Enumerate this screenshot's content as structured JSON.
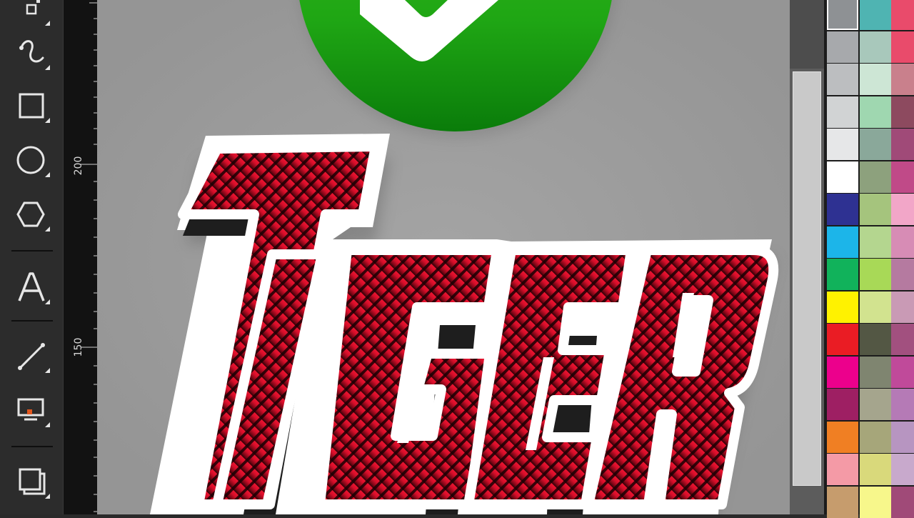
{
  "app": {
    "title": ""
  },
  "ruler": {
    "labels": [
      "200",
      "150"
    ]
  },
  "tools": [
    {
      "name": "shape-edit-tool",
      "icon": "node-edit-icon"
    },
    {
      "name": "freehand-tool",
      "icon": "curve-icon"
    },
    {
      "name": "rectangle-tool",
      "icon": "rectangle-icon"
    },
    {
      "name": "ellipse-tool",
      "icon": "ellipse-icon"
    },
    {
      "name": "polygon-tool",
      "icon": "hexagon-icon"
    },
    {
      "name": "text-tool",
      "icon": "text-icon",
      "label": "A"
    },
    {
      "name": "dimension-tool",
      "icon": "line-icon"
    },
    {
      "name": "interactive-fill-tool",
      "icon": "fill-icon"
    },
    {
      "name": "transparency-tool",
      "icon": "stack-icon"
    }
  ],
  "artwork": {
    "logo_text": "TIGER",
    "badge_icon": "checkmark-icon",
    "colors": {
      "badge_green_top": "#3cc21f",
      "badge_green_bottom": "#0a7c0a",
      "letter_red": "#d40e2a",
      "letter_dark": "#2a0006",
      "outline_white": "#ffffff",
      "shadow": "#1e1e1e"
    }
  },
  "palette": {
    "selected_index": 0,
    "columns": [
      [
        "#8e9194",
        "#a7a9ac",
        "#bcbec0",
        "#d1d3d4",
        "#e6e7e8",
        "#ffffff",
        "#2e3192",
        "#1cb5e9",
        "#11b25b",
        "#fff200",
        "#ea1c24",
        "#ec008c",
        "#9e1f63",
        "#f07f23",
        "#f49aa6",
        "#c69c6d"
      ],
      [
        "#4fb4b2",
        "#a8c8bb",
        "#cde6d5",
        "#9fd7b0",
        "#8aa89a",
        "#8da17d",
        "#a5c47d",
        "#b4d68f",
        "#a8d957",
        "#d2e38f",
        "#535744",
        "#7f8570",
        "#a5a58d",
        "#a6a67a",
        "#d9d97b",
        "#f7f78b"
      ],
      [
        "#e94b6b",
        "#e94b6b",
        "#c9808c",
        "#8d4a5f",
        "#a04a78",
        "#c04a88",
        "#f2a6c8",
        "#d78cb5",
        "#b57aa0",
        "#c99ab5",
        "#a2507f",
        "#c04a9a",
        "#b57ab6",
        "#b795c1",
        "#c8a9cc",
        "#a04a78"
      ]
    ]
  }
}
